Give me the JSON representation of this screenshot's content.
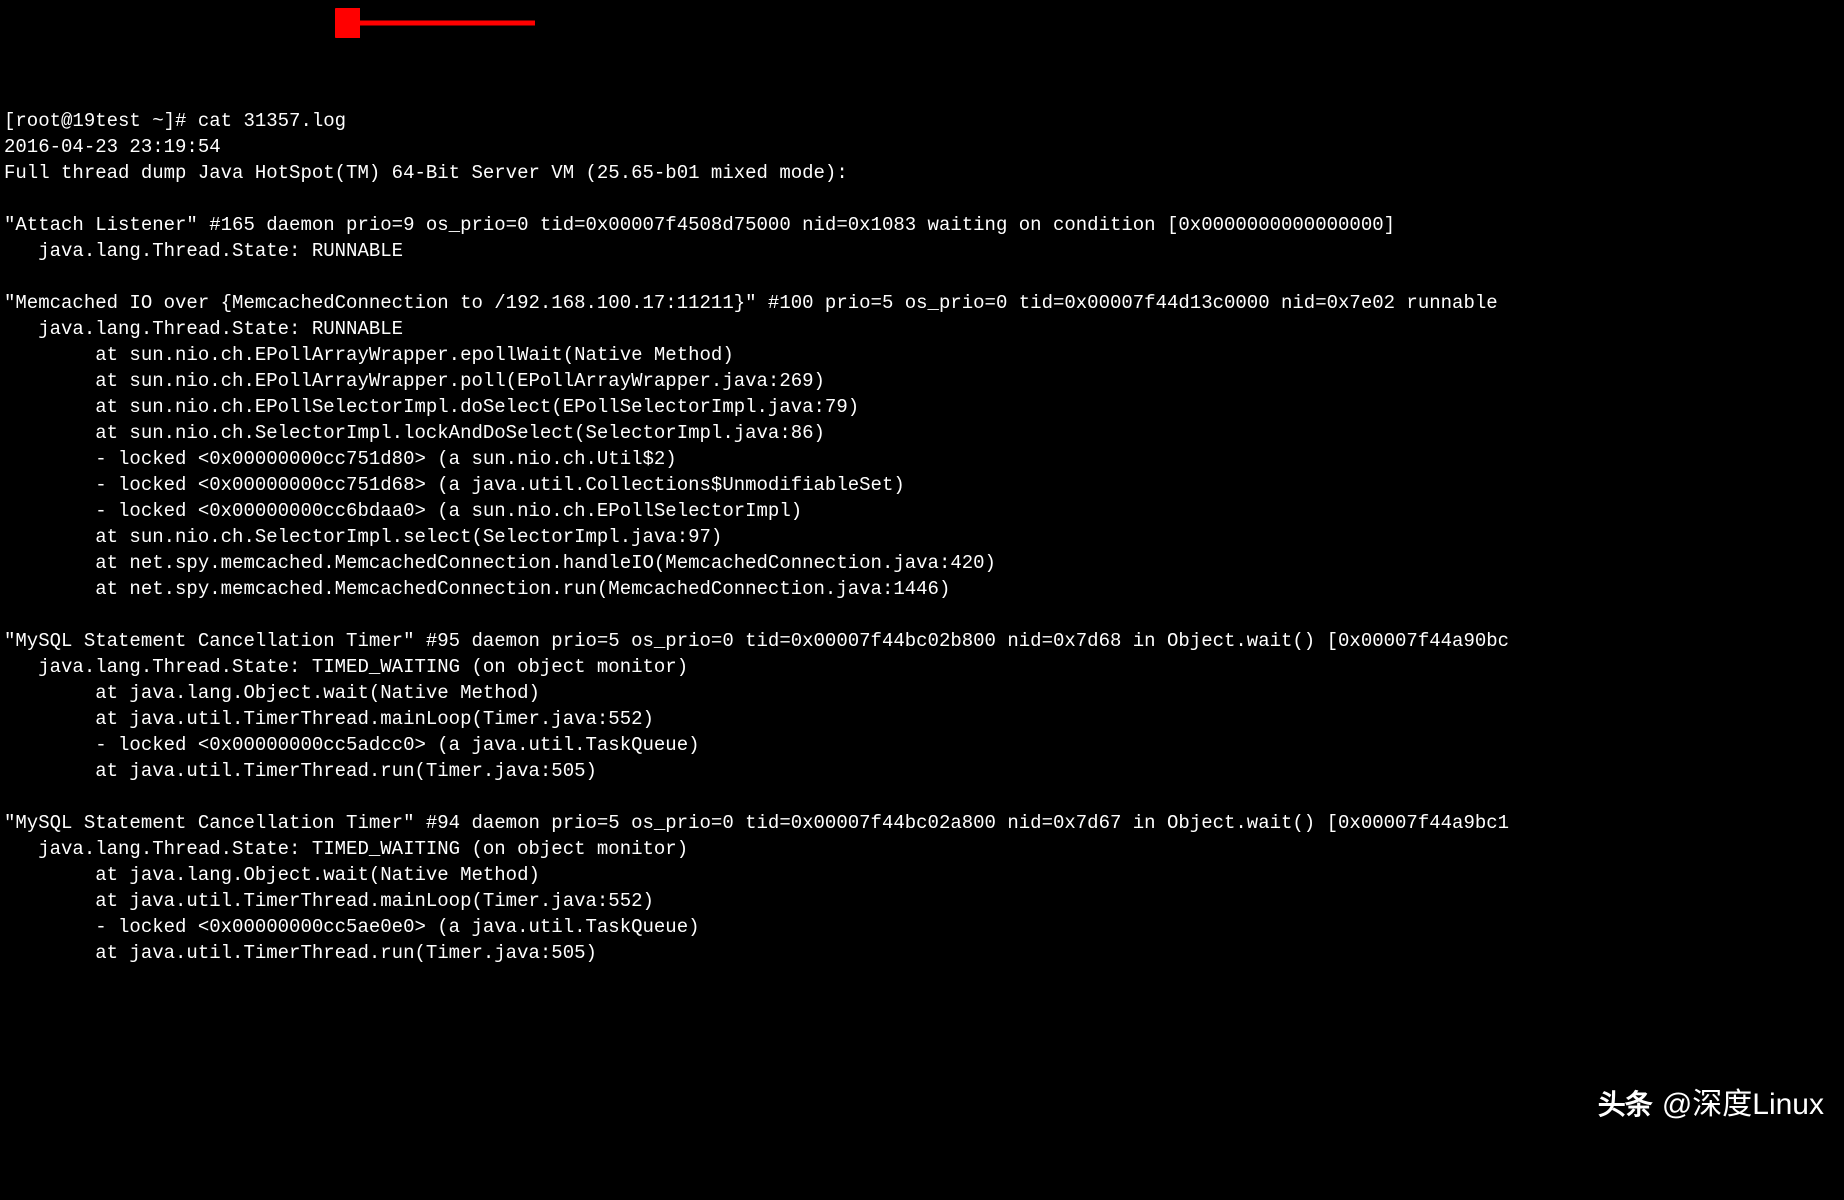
{
  "prompt": "[root@19test ~]# cat 31357.log",
  "lines": [
    "2016-04-23 23:19:54",
    "Full thread dump Java HotSpot(TM) 64-Bit Server VM (25.65-b01 mixed mode):",
    "",
    "\"Attach Listener\" #165 daemon prio=9 os_prio=0 tid=0x00007f4508d75000 nid=0x1083 waiting on condition [0x0000000000000000]",
    "   java.lang.Thread.State: RUNNABLE",
    "",
    "\"Memcached IO over {MemcachedConnection to /192.168.100.17:11211}\" #100 prio=5 os_prio=0 tid=0x00007f44d13c0000 nid=0x7e02 runnable",
    "   java.lang.Thread.State: RUNNABLE",
    "        at sun.nio.ch.EPollArrayWrapper.epollWait(Native Method)",
    "        at sun.nio.ch.EPollArrayWrapper.poll(EPollArrayWrapper.java:269)",
    "        at sun.nio.ch.EPollSelectorImpl.doSelect(EPollSelectorImpl.java:79)",
    "        at sun.nio.ch.SelectorImpl.lockAndDoSelect(SelectorImpl.java:86)",
    "        - locked <0x00000000cc751d80> (a sun.nio.ch.Util$2)",
    "        - locked <0x00000000cc751d68> (a java.util.Collections$UnmodifiableSet)",
    "        - locked <0x00000000cc6bdaa0> (a sun.nio.ch.EPollSelectorImpl)",
    "        at sun.nio.ch.SelectorImpl.select(SelectorImpl.java:97)",
    "        at net.spy.memcached.MemcachedConnection.handleIO(MemcachedConnection.java:420)",
    "        at net.spy.memcached.MemcachedConnection.run(MemcachedConnection.java:1446)",
    "",
    "\"MySQL Statement Cancellation Timer\" #95 daemon prio=5 os_prio=0 tid=0x00007f44bc02b800 nid=0x7d68 in Object.wait() [0x00007f44a90bc",
    "   java.lang.Thread.State: TIMED_WAITING (on object monitor)",
    "        at java.lang.Object.wait(Native Method)",
    "        at java.util.TimerThread.mainLoop(Timer.java:552)",
    "        - locked <0x00000000cc5adcc0> (a java.util.TaskQueue)",
    "        at java.util.TimerThread.run(Timer.java:505)",
    "",
    "\"MySQL Statement Cancellation Timer\" #94 daemon prio=5 os_prio=0 tid=0x00007f44bc02a800 nid=0x7d67 in Object.wait() [0x00007f44a9bc1",
    "   java.lang.Thread.State: TIMED_WAITING (on object monitor)",
    "        at java.lang.Object.wait(Native Method)",
    "        at java.util.TimerThread.mainLoop(Timer.java:552)",
    "        - locked <0x00000000cc5ae0e0> (a java.util.TaskQueue)",
    "        at java.util.TimerThread.run(Timer.java:505)"
  ],
  "arrow_color": "#ff0000",
  "watermark": {
    "logo": "头条",
    "text": "@深度Linux"
  }
}
